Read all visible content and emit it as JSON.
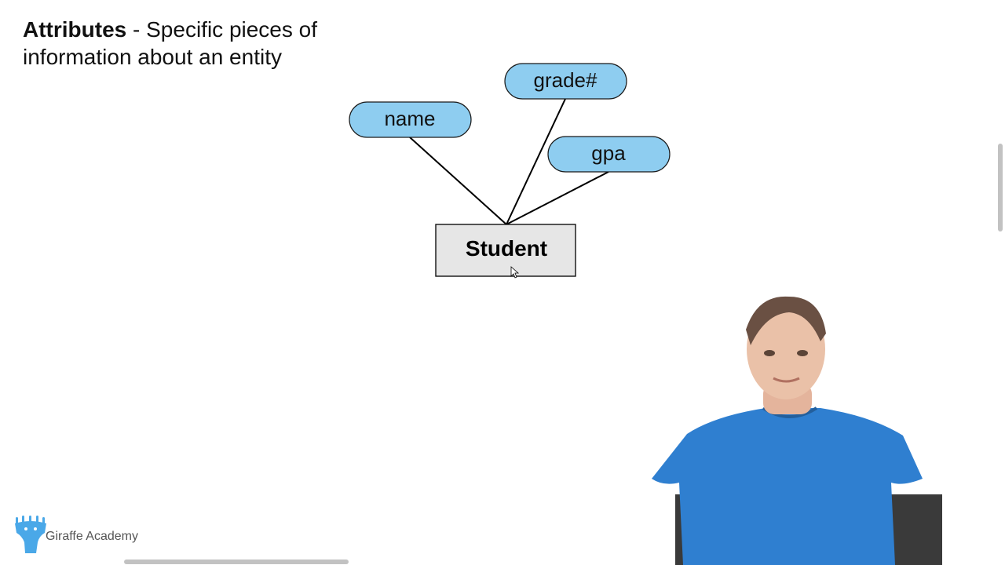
{
  "slide": {
    "title_term": "Attributes",
    "title_rest": " - Specific pieces of information about an entity"
  },
  "diagram": {
    "entity": "Student",
    "attributes": [
      "name",
      "grade#",
      "gpa"
    ]
  },
  "brand": {
    "label": "Giraffe Academy",
    "icon": "giraffe-icon",
    "color": "#4aa8e8"
  },
  "colors": {
    "attribute_fill": "#8ecdf0",
    "entity_fill": "#e6e6e6",
    "presenter_shirt": "#2f7fd0"
  }
}
